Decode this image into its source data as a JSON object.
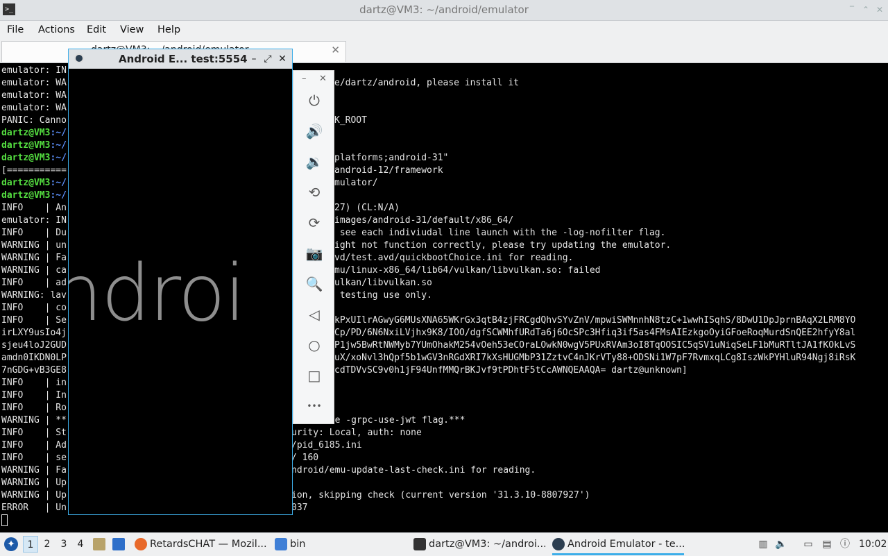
{
  "terminal": {
    "window_title": "dartz@VM3: ~/android/emulator",
    "menu": [
      "File",
      "Actions",
      "Edit",
      "View",
      "Help"
    ],
    "tab_title": "dartz@VM3: ~/android/emulator",
    "left_lines": [
      {
        "text": "emulator: IN"
      },
      {
        "text": "emulator: WA"
      },
      {
        "text": "emulator: WA"
      },
      {
        "text": "emulator: WA"
      },
      {
        "text": "PANIC: Canno"
      },
      {
        "prompt": "dartz@VM3",
        "path": ":~/"
      },
      {
        "prompt": "dartz@VM3",
        "path": ":~/"
      },
      {
        "prompt": "dartz@VM3",
        "path": ":~/"
      },
      {
        "text": "[==========="
      },
      {
        "prompt": "dartz@VM3",
        "path": ":~/"
      },
      {
        "prompt": "dartz@VM3",
        "path": ":~/"
      },
      {
        "text": "INFO    | An"
      },
      {
        "text": "emulator: IN"
      },
      {
        "text": "INFO    | Du"
      },
      {
        "text": "WARNING | un"
      },
      {
        "text": "WARNING | Fa"
      },
      {
        "text": "WARNING | ca"
      },
      {
        "text": "INFO    | ad"
      },
      {
        "text": "WARNING: lav"
      },
      {
        "text": "INFO    | co"
      },
      {
        "text": "INFO    | Se"
      },
      {
        "text": "irLXY9usIo4j"
      },
      {
        "text": "sjeu4loJ2GUD"
      },
      {
        "text": "amdn0IKDN0LP"
      },
      {
        "text": "7nGDG+vB3GE8"
      },
      {
        "text": "INFO    | in"
      },
      {
        "text": "INFO    | In"
      },
      {
        "text": "INFO    | Ro"
      },
      {
        "text": "WARNING | **"
      },
      {
        "text": "INFO    | St"
      },
      {
        "text": "INFO    | Ad"
      },
      {
        "text": "INFO    | se"
      },
      {
        "text": "WARNING | Fa"
      },
      {
        "text": "WARNING | Up"
      },
      {
        "text": "WARNING | Up"
      },
      {
        "text": "ERROR   | Un"
      }
    ],
    "right_lines": [
      "",
      "e/dartz/android, please install it",
      "",
      "",
      "K_ROOT",
      "",
      "",
      "platforms;android-31\"",
      "android-12/framework",
      "mulator/",
      "",
      "27) (CL:N/A)",
      "images/android-31/default/x86_64/",
      " see each indiviudal line launch with the -log-nofilter flag.",
      "ight not function correctly, please try updating the emulator.",
      "vd/test.avd/quickbootChoice.ini for reading.",
      "mu/linux-x86_64/lib64/vulkan/libvulkan.so: failed",
      "ulkan/libvulkan.so",
      " testing use only.",
      "",
      "kPxUIlrAGwyG6MUsXNA65WKrGx3qtB4zjFRCgdQhvSYvZnV/mpwiSWMnnhN8tzC+1wwhISqhS/8DwU1DpJprnBAqX2LRM8YO",
      "Cp/PD/6N6NxiLVjhx9K8/IOO/dgfSCWMhfURdTa6j6OcSPc3Hfiq3if5as4FMsAIEzkgoOyiGFoeRoqMurdSnQEE2hfyY8al",
      "P1jw5BwRtNWMyb7YUmOhakM254vOeh53eCOraLOwkN0wgV5PUxRVAm3oI8TqOOSIC5qSV1uNiqSeLF1bMuRTltJA1fKOkLvS",
      "uX/xoNvl3hQpf5b1wGV3nRGdXRI7kXsHUGMbP31ZztvC4nJKrVTy88+ODSNi1W7pF7RvmxqLCg8IszWkPYHluR94Ngj8iRsK",
      "cdTDVvSC9v0h1jF94UnfMMQrBKJvf9tPDhtF5tCcAWNQEAAQA= dartz@unknown]",
      "",
      "",
      "",
      " with the -grpc-use-jwt flag.***",
      "urity: Local, auth: none",
      "/pid_6185.ini",
      "/ 160",
      "ndroid/emu-update-last-check.ini for reading.",
      "",
      "ion, skipping check (current version '31.3.10-8807927')",
      "037"
    ]
  },
  "emulator": {
    "window_title": "Android E... test:5554",
    "boot_text": "ndroi",
    "toolbar": [
      {
        "name": "power-icon",
        "glyph": "⏻"
      },
      {
        "name": "volume-up-icon",
        "glyph": "🔊"
      },
      {
        "name": "volume-down-icon",
        "glyph": "🔉"
      },
      {
        "name": "rotate-left-icon",
        "glyph": "⟲"
      },
      {
        "name": "rotate-right-icon",
        "glyph": "⟳"
      },
      {
        "name": "camera-icon",
        "glyph": "📷"
      },
      {
        "name": "zoom-icon",
        "glyph": "🔍"
      },
      {
        "name": "back-icon",
        "glyph": "◁"
      },
      {
        "name": "home-icon",
        "glyph": "○"
      },
      {
        "name": "overview-icon",
        "glyph": "□"
      },
      {
        "name": "more-icon",
        "glyph": "•••"
      }
    ]
  },
  "taskbar": {
    "workspaces": [
      "1",
      "2",
      "3",
      "4"
    ],
    "tasks": [
      {
        "label": "RetardsCHAT — Mozil...",
        "icon": "firefox-icon",
        "color": "#e8692a"
      },
      {
        "label": "bin",
        "icon": "folder-icon",
        "color": "#3f7fd6"
      },
      {
        "label": "dartz@VM3: ~/androi...",
        "icon": "terminal-icon",
        "color": "#333333"
      },
      {
        "label": "Android Emulator - te...",
        "icon": "android-emulator-icon",
        "color": "#2c3e50"
      }
    ],
    "clock": "10:02"
  },
  "colors": {
    "accent": "#3daee9",
    "prompt": "#55e041",
    "path": "#5b8ff9"
  }
}
